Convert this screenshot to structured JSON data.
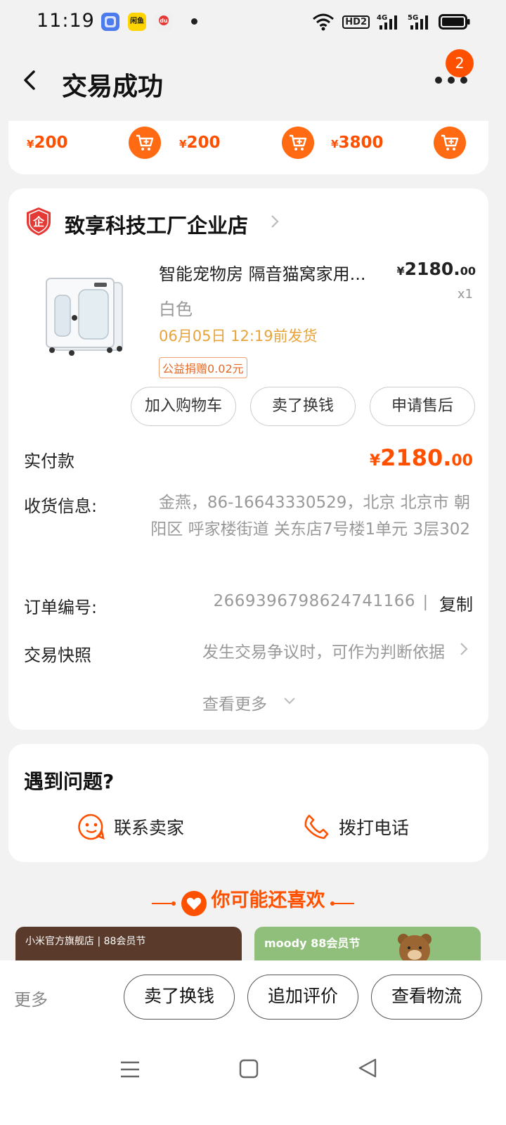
{
  "status": {
    "time": "11:19",
    "apps": [
      {
        "name": "copilot-app-icon",
        "color": "#4b7bec"
      },
      {
        "name": "xianyu-app-icon",
        "color": "#ffd400",
        "label": "闲鱼"
      },
      {
        "name": "du-app-icon",
        "color": "#e8e8e8"
      }
    ],
    "network": [
      "4G",
      "5G"
    ],
    "hd_label": "HD2"
  },
  "header": {
    "title": "交易成功",
    "badge_count": "2"
  },
  "recommend_strip": {
    "items": [
      {
        "currency": "¥",
        "price": "200"
      },
      {
        "currency": "¥",
        "price": "200"
      },
      {
        "currency": "¥",
        "price": "3800"
      }
    ]
  },
  "order": {
    "shop_logo_text": "企",
    "shop_name": "致享科技工厂企业店",
    "product": {
      "title": "智能宠物房 隔音猫窝家用...",
      "currency": "¥",
      "price_int": "2180.",
      "price_dec": "00",
      "qty": "x1",
      "variant": "白色",
      "ship_by": "06月05日 12:19前发货",
      "charity": "公益捐赠0.02元"
    },
    "actions": [
      "加入购物车",
      "卖了换钱",
      "申请售后"
    ],
    "paid": {
      "label": "实付款",
      "currency": "¥",
      "amount_int": "2180.",
      "amount_dec": "00"
    },
    "address": {
      "label": "收货信息:",
      "value": "金燕，86-16643330529，北京 北京市 朝阳区 呼家楼街道 关东店7号楼1单元 3层302"
    },
    "order_number": {
      "label": "订单编号:",
      "value": "2669396798624741166",
      "separator": "|",
      "copy": "复制"
    },
    "snapshot": {
      "label": "交易快照",
      "hint": "发生交易争议时，可作为判断依据"
    },
    "view_more": "查看更多"
  },
  "help": {
    "title": "遇到问题?",
    "contact_seller": "联系卖家",
    "call": "拨打电话"
  },
  "guess": {
    "title": "你可能还喜欢"
  },
  "ads": [
    {
      "text": "小米官方旗舰店 | 88会员节",
      "color": "#5a3a2a"
    },
    {
      "text": "moody 88会员节",
      "color": "#8fbf7a"
    }
  ],
  "bottom": {
    "more": "更多",
    "buttons": [
      "卖了换钱",
      "追加评价",
      "查看物流"
    ]
  },
  "colors": {
    "accent": "#ff5000",
    "ship_text": "#e8a33a",
    "background": "#f2f2f2"
  }
}
